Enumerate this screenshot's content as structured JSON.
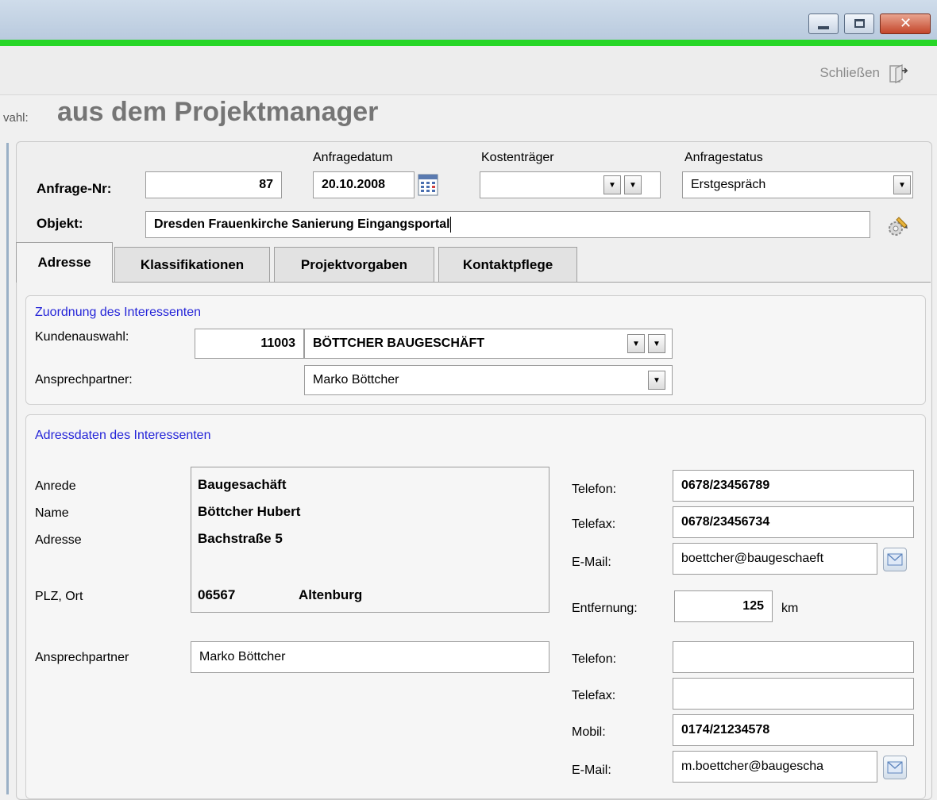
{
  "window": {
    "close_label": "Schließen"
  },
  "header": {
    "prefix": "vahl:",
    "title": "aus dem Projektmanager"
  },
  "form": {
    "anfrage_nr": {
      "label": "Anfrage-Nr:",
      "value": "87"
    },
    "anfragedatum": {
      "label": "Anfragedatum",
      "value": "20.10.2008"
    },
    "kostentraeger": {
      "label": "Kostenträger",
      "value": ""
    },
    "anfragestatus": {
      "label": "Anfragestatus",
      "value": "Erstgespräch"
    },
    "objekt": {
      "label": "Objekt:",
      "value": "Dresden Frauenkirche Sanierung Eingangsportal"
    }
  },
  "tabs": [
    {
      "label": "Adresse",
      "active": true
    },
    {
      "label": "Klassifikationen",
      "active": false
    },
    {
      "label": "Projektvorgaben",
      "active": false
    },
    {
      "label": "Kontaktpflege",
      "active": false
    }
  ],
  "zuordnung": {
    "title": "Zuordnung des Interessenten",
    "kundenauswahl_label": "Kundenauswahl:",
    "kunden_nr": "11003",
    "kunden_name": "BÖTTCHER BAUGESCHÄFT",
    "ansprechpartner_label": "Ansprechpartner:",
    "ansprechpartner_value": "Marko Böttcher"
  },
  "adressdaten": {
    "title": "Adressdaten des Interessenten",
    "anrede_label": "Anrede",
    "name_label": "Name",
    "adresse_label": "Adresse",
    "plz_ort_label": "PLZ, Ort",
    "anrede": "Baugesachäft",
    "name": "Böttcher Hubert",
    "adresse": "Bachstraße 5",
    "plz": "06567",
    "ort": "Altenburg",
    "telefon_label": "Telefon:",
    "telefon": "0678/23456789",
    "telefax_label": "Telefax:",
    "telefax": "0678/23456734",
    "email_label": "E-Mail:",
    "email": "boettcher@baugeschaeft",
    "entfernung_label": "Entfernung:",
    "entfernung": "125",
    "entfernung_unit": "km",
    "ap_label": "Ansprechpartner",
    "ap_value": "Marko Böttcher",
    "ap_telefon_label": "Telefon:",
    "ap_telefon": "",
    "ap_telefax_label": "Telefax:",
    "ap_telefax": "",
    "ap_mobil_label": "Mobil:",
    "ap_mobil": "0174/21234578",
    "ap_email_label": "E-Mail:",
    "ap_email": "m.boettcher@baugescha"
  },
  "colors": {
    "accent_green": "#27d627",
    "group_title_blue": "#2424d8",
    "titlebar": "#c4d3e4"
  }
}
